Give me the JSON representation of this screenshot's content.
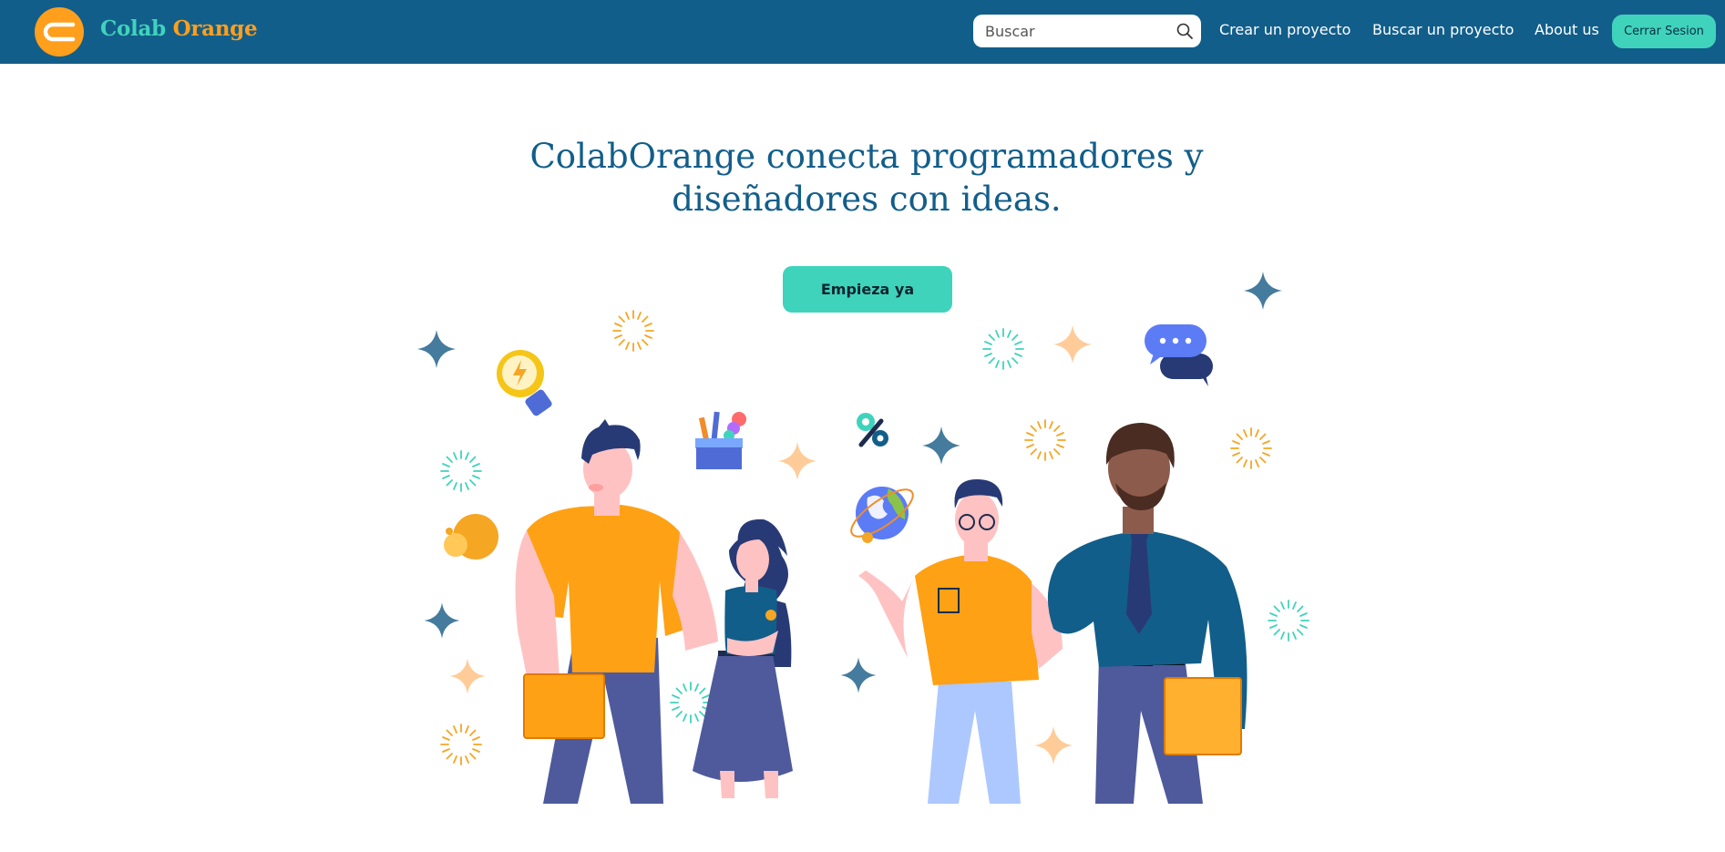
{
  "navbar": {
    "brand_part1": "Colab",
    "brand_part2": "Orange",
    "logo_icon": "colab-orange-logo",
    "search": {
      "placeholder": "Buscar",
      "value": "",
      "icon": "search-icon"
    },
    "links": [
      "Crear un proyecto",
      "Buscar un proyecto",
      "About us"
    ],
    "logout_label": "Cerrar Sesion"
  },
  "hero": {
    "title": "ColabOrange conecta programadores y diseñadores con ideas.",
    "cta_label": "Empieza ya",
    "illustration": "team-of-four-people-with-icons"
  },
  "colors": {
    "navbar_bg": "#125e8a",
    "accent_teal": "#40d3bc",
    "brand_orange": "#ff9f1c",
    "title_blue": "#125e8a",
    "background": "#ffffff"
  }
}
